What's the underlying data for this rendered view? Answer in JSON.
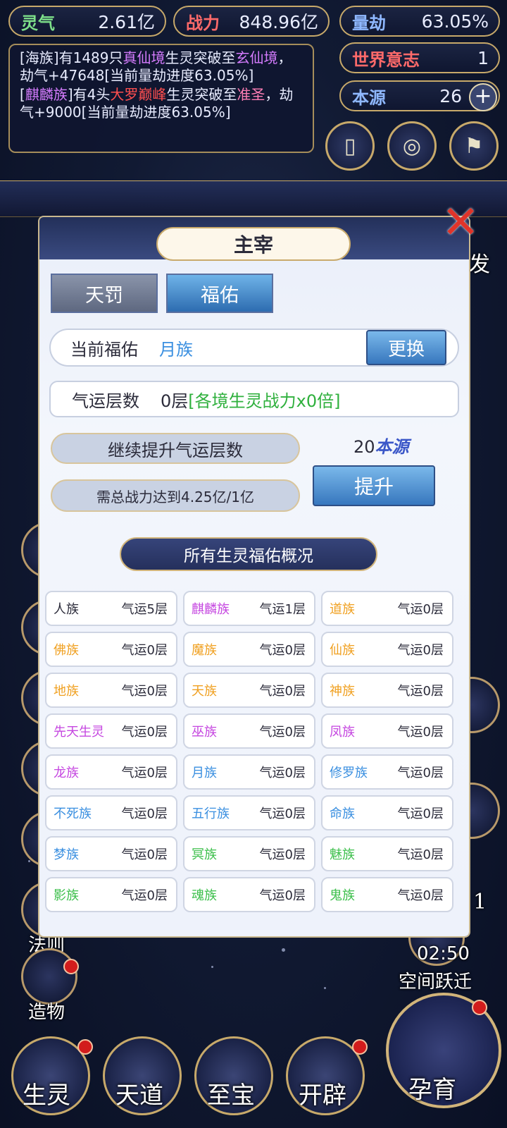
{
  "stats": {
    "lingqi": {
      "label": "灵气",
      "value": "2.61亿"
    },
    "zhanli": {
      "label": "战力",
      "value": "848.96亿"
    },
    "liangjie": {
      "label": "量劫",
      "value": "63.05%"
    },
    "shijie": {
      "label": "世界意志",
      "value": "1"
    },
    "benyuan": {
      "label": "本源",
      "value": "26",
      "plus": "+"
    }
  },
  "log": {
    "m1_a": "[海族]有1489只",
    "m1_b": "真仙境",
    "m1_c": "生灵突破至",
    "m1_d": "玄仙境",
    "m1_e": "，劫气+47648[当前量劫进度63.05%]",
    "m2_a": "[",
    "m2_b": "麒麟族",
    "m2_c": "]有4头",
    "m2_d": "大罗巅峰",
    "m2_e": "生灵突破至",
    "m2_f": "准圣",
    "m2_g": "，劫气+9000[当前量劫进度63.05%]"
  },
  "side": {
    "fa": "发",
    "fazi": "法则",
    "zaowu": "造物",
    "timer": "02:50",
    "kongjian": "空间跃迁",
    "badge": "1"
  },
  "nav": {
    "shengling": "生灵",
    "tiandao": "天道",
    "zhibao": "至宝",
    "kaipi": "开辟",
    "yunyu": "孕育"
  },
  "modal": {
    "title": "主宰",
    "close": "✕",
    "tabs": {
      "tianfa": "天罚",
      "fuyou": "福佑"
    },
    "current_label": "当前福佑",
    "current_value": "月族",
    "change_btn": "更换",
    "qiyun_label": "气运层数",
    "qiyun_value": "0层",
    "qiyun_bonus": "[各境生灵战力x0倍]",
    "continue_text": "继续提升气运层数",
    "cost_num": "20",
    "cost_unit": "本源",
    "require_text": "需总战力达到4.25亿/1亿",
    "upgrade_btn": "提升",
    "banner": "所有生灵福佑概况",
    "races": [
      {
        "name": "人族",
        "level": "气运5层",
        "color": "#2b2b3a"
      },
      {
        "name": "麒麟族",
        "level": "气运1层",
        "color": "#c546e0"
      },
      {
        "name": "道族",
        "level": "气运0层",
        "color": "#f0a020"
      },
      {
        "name": "佛族",
        "level": "气运0层",
        "color": "#f0a020"
      },
      {
        "name": "魔族",
        "level": "气运0层",
        "color": "#f0a020"
      },
      {
        "name": "仙族",
        "level": "气运0层",
        "color": "#f0a020"
      },
      {
        "name": "地族",
        "level": "气运0层",
        "color": "#f0a020"
      },
      {
        "name": "天族",
        "level": "气运0层",
        "color": "#f0a020"
      },
      {
        "name": "神族",
        "level": "气运0层",
        "color": "#f0a020"
      },
      {
        "name": "先天生灵",
        "level": "气运0层",
        "color": "#c546e0"
      },
      {
        "name": "巫族",
        "level": "气运0层",
        "color": "#c546e0"
      },
      {
        "name": "凤族",
        "level": "气运0层",
        "color": "#c546e0"
      },
      {
        "name": "龙族",
        "level": "气运0层",
        "color": "#c546e0"
      },
      {
        "name": "月族",
        "level": "气运0层",
        "color": "#3a8fe0"
      },
      {
        "name": "修罗族",
        "level": "气运0层",
        "color": "#3a8fe0"
      },
      {
        "name": "不死族",
        "level": "气运0层",
        "color": "#3a8fe0"
      },
      {
        "name": "五行族",
        "level": "气运0层",
        "color": "#3a8fe0"
      },
      {
        "name": "命族",
        "level": "气运0层",
        "color": "#3a8fe0"
      },
      {
        "name": "梦族",
        "level": "气运0层",
        "color": "#3a8fe0"
      },
      {
        "name": "冥族",
        "level": "气运0层",
        "color": "#3bbf4a"
      },
      {
        "name": "魅族",
        "level": "气运0层",
        "color": "#3bbf4a"
      },
      {
        "name": "影族",
        "level": "气运0层",
        "color": "#3bbf4a"
      },
      {
        "name": "魂族",
        "level": "气运0层",
        "color": "#3bbf4a"
      },
      {
        "name": "鬼族",
        "level": "气运0层",
        "color": "#3bbf4a"
      }
    ]
  }
}
